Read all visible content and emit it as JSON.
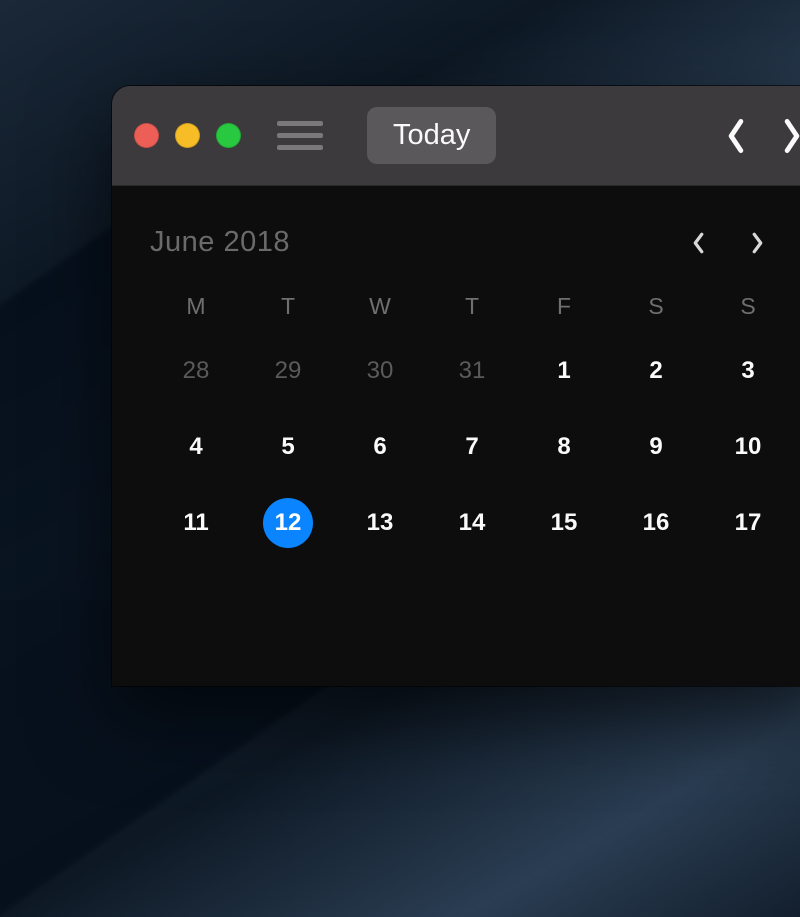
{
  "toolbar": {
    "today_label": "Today"
  },
  "calendar": {
    "month_label": "June 2018",
    "dow": [
      "M",
      "T",
      "W",
      "T",
      "F",
      "S",
      "S"
    ],
    "rows": [
      [
        {
          "n": "28",
          "kind": "other"
        },
        {
          "n": "29",
          "kind": "other"
        },
        {
          "n": "30",
          "kind": "other"
        },
        {
          "n": "31",
          "kind": "other"
        },
        {
          "n": "1",
          "kind": "current"
        },
        {
          "n": "2",
          "kind": "current"
        },
        {
          "n": "3",
          "kind": "current"
        }
      ],
      [
        {
          "n": "4",
          "kind": "current"
        },
        {
          "n": "5",
          "kind": "current"
        },
        {
          "n": "6",
          "kind": "current"
        },
        {
          "n": "7",
          "kind": "current"
        },
        {
          "n": "8",
          "kind": "current"
        },
        {
          "n": "9",
          "kind": "current"
        },
        {
          "n": "10",
          "kind": "current"
        }
      ],
      [
        {
          "n": "11",
          "kind": "current"
        },
        {
          "n": "12",
          "kind": "selected"
        },
        {
          "n": "13",
          "kind": "current"
        },
        {
          "n": "14",
          "kind": "current"
        },
        {
          "n": "15",
          "kind": "current"
        },
        {
          "n": "16",
          "kind": "current"
        },
        {
          "n": "17",
          "kind": "current"
        }
      ]
    ]
  },
  "colors": {
    "accent": "#0a84ff",
    "titlebar": "#3c3a3c",
    "panel": "#0d0d0d"
  }
}
